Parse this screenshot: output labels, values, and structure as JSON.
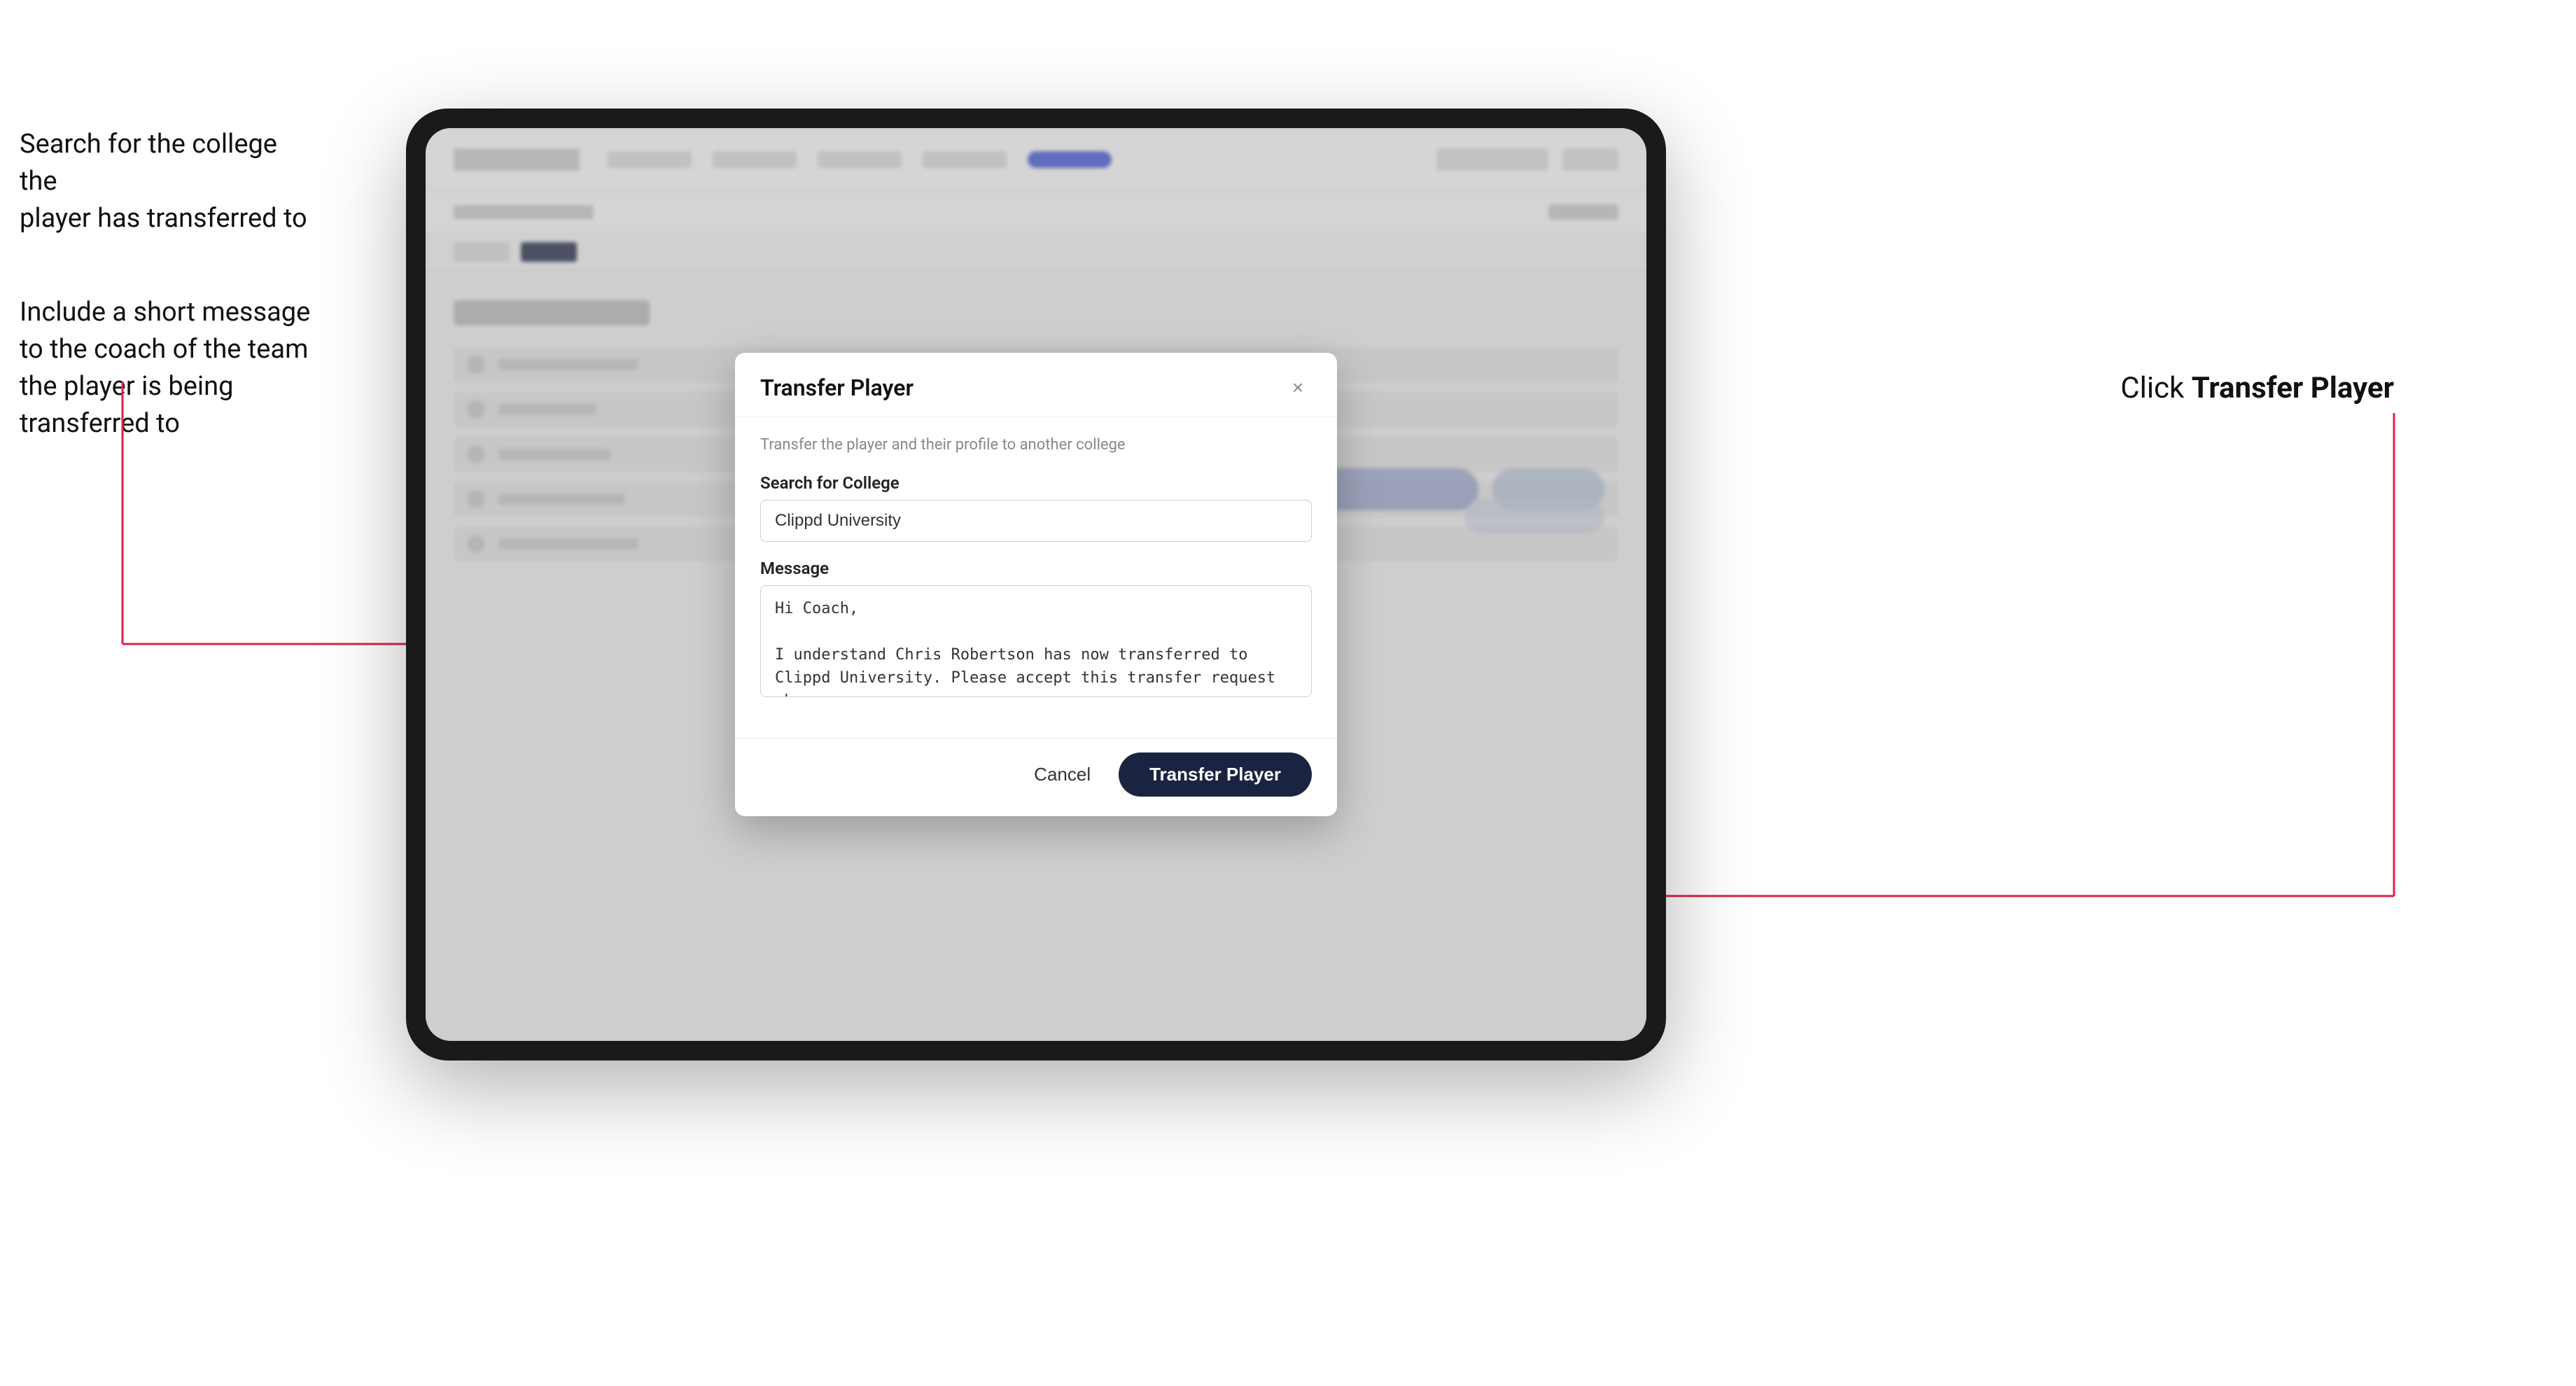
{
  "annotations": {
    "left_text_line1": "Search for the college the\nplayer has transferred to",
    "left_text_line2": "Include a short message\nto the coach of the team\nthe player is being\ntransferred to",
    "right_text_prefix": "Click ",
    "right_text_bold": "Transfer Player"
  },
  "tablet": {
    "nav": {
      "logo_alt": "Clippd logo"
    }
  },
  "modal": {
    "title": "Transfer Player",
    "close_label": "×",
    "subtitle": "Transfer the player and their profile to another college",
    "college_label": "Search for College",
    "college_value": "Clippd University",
    "college_placeholder": "Search for College",
    "message_label": "Message",
    "message_value": "Hi Coach,\n\nI understand Chris Robertson has now transferred to Clippd University. Please accept this transfer request when you can.",
    "cancel_label": "Cancel",
    "transfer_label": "Transfer Player"
  }
}
